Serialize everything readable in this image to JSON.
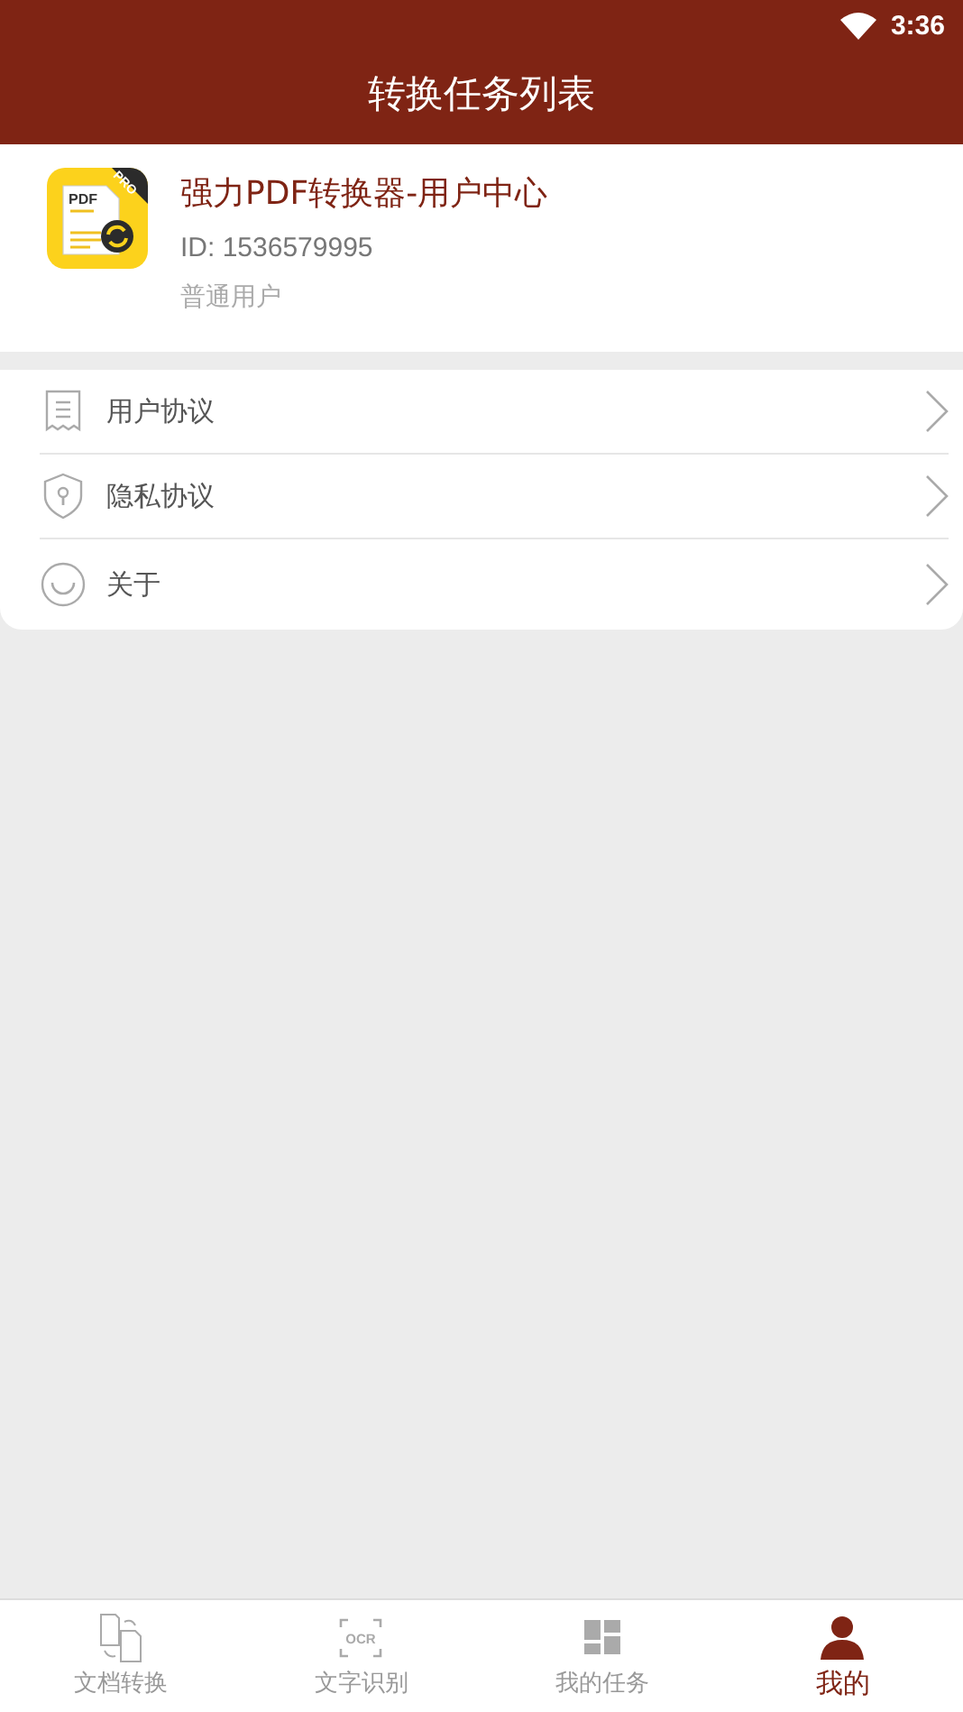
{
  "status_bar": {
    "time": "3:36"
  },
  "header": {
    "title": "转换任务列表"
  },
  "profile": {
    "app_icon": {
      "label": "PDF",
      "badge": "PRO"
    },
    "name": "强力PDF转换器-用户中心",
    "id": "ID: 1536579995",
    "level": "普通用户"
  },
  "menu": [
    {
      "kind": "document",
      "label": "用户协议"
    },
    {
      "kind": "shield",
      "label": "隐私协议"
    },
    {
      "kind": "smile",
      "label": "关于"
    }
  ],
  "bottom_nav": [
    {
      "kind": "convert",
      "label": "文档转换",
      "selected": false
    },
    {
      "kind": "ocr",
      "label": "文字识别",
      "icon_text": "OCR",
      "selected": false
    },
    {
      "kind": "tasks",
      "label": "我的任务",
      "selected": false
    },
    {
      "kind": "person",
      "label": "我的",
      "selected": true
    }
  ]
}
